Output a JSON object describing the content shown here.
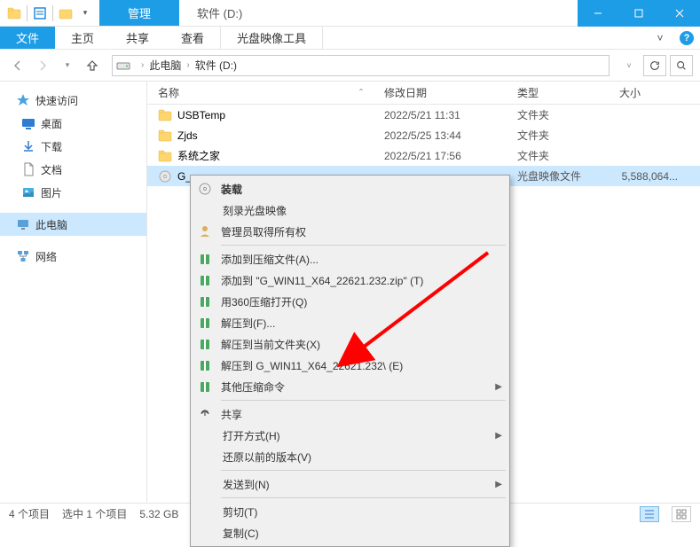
{
  "titlebar": {
    "contextual_tab": "管理",
    "window_title": "软件 (D:)"
  },
  "ribbon": {
    "file": "文件",
    "tabs": [
      "主页",
      "共享",
      "查看"
    ],
    "tool_tab": "光盘映像工具"
  },
  "breadcrumb": {
    "root": "此电脑",
    "current": "软件 (D:)"
  },
  "columns": {
    "name": "名称",
    "date": "修改日期",
    "type": "类型",
    "size": "大小"
  },
  "sidebar": {
    "quick_access": "快速访问",
    "desktop": "桌面",
    "downloads": "下载",
    "documents": "文档",
    "pictures": "图片",
    "this_pc": "此电脑",
    "network": "网络"
  },
  "files": [
    {
      "name": "USBTemp",
      "date": "2022/5/21 11:31",
      "type": "文件夹",
      "size": ""
    },
    {
      "name": "Zjds",
      "date": "2022/5/25 13:44",
      "type": "文件夹",
      "size": ""
    },
    {
      "name": "系统之家",
      "date": "2022/5/21 17:56",
      "type": "文件夹",
      "size": ""
    },
    {
      "name": "G_",
      "date": "",
      "type": "光盘映像文件",
      "size": "5,588,064..."
    }
  ],
  "context_menu": {
    "mount": "装载",
    "burn": "刻录光盘映像",
    "admin_own": "管理员取得所有权",
    "add_archive": "添加到压缩文件(A)...",
    "add_zip": "添加到 \"G_WIN11_X64_22621.232.zip\" (T)",
    "open_360": "用360压缩打开(Q)",
    "extract_to": "解压到(F)...",
    "extract_here": "解压到当前文件夹(X)",
    "extract_named": "解压到 G_WIN11_X64_22621.232\\ (E)",
    "other_zip": "其他压缩命令",
    "share": "共享",
    "open_with": "打开方式(H)",
    "restore": "还原以前的版本(V)",
    "send_to": "发送到(N)",
    "cut": "剪切(T)",
    "copy": "复制(C)"
  },
  "statusbar": {
    "count": "4 个项目",
    "selected": "选中 1 个项目",
    "size": "5.32 GB"
  }
}
